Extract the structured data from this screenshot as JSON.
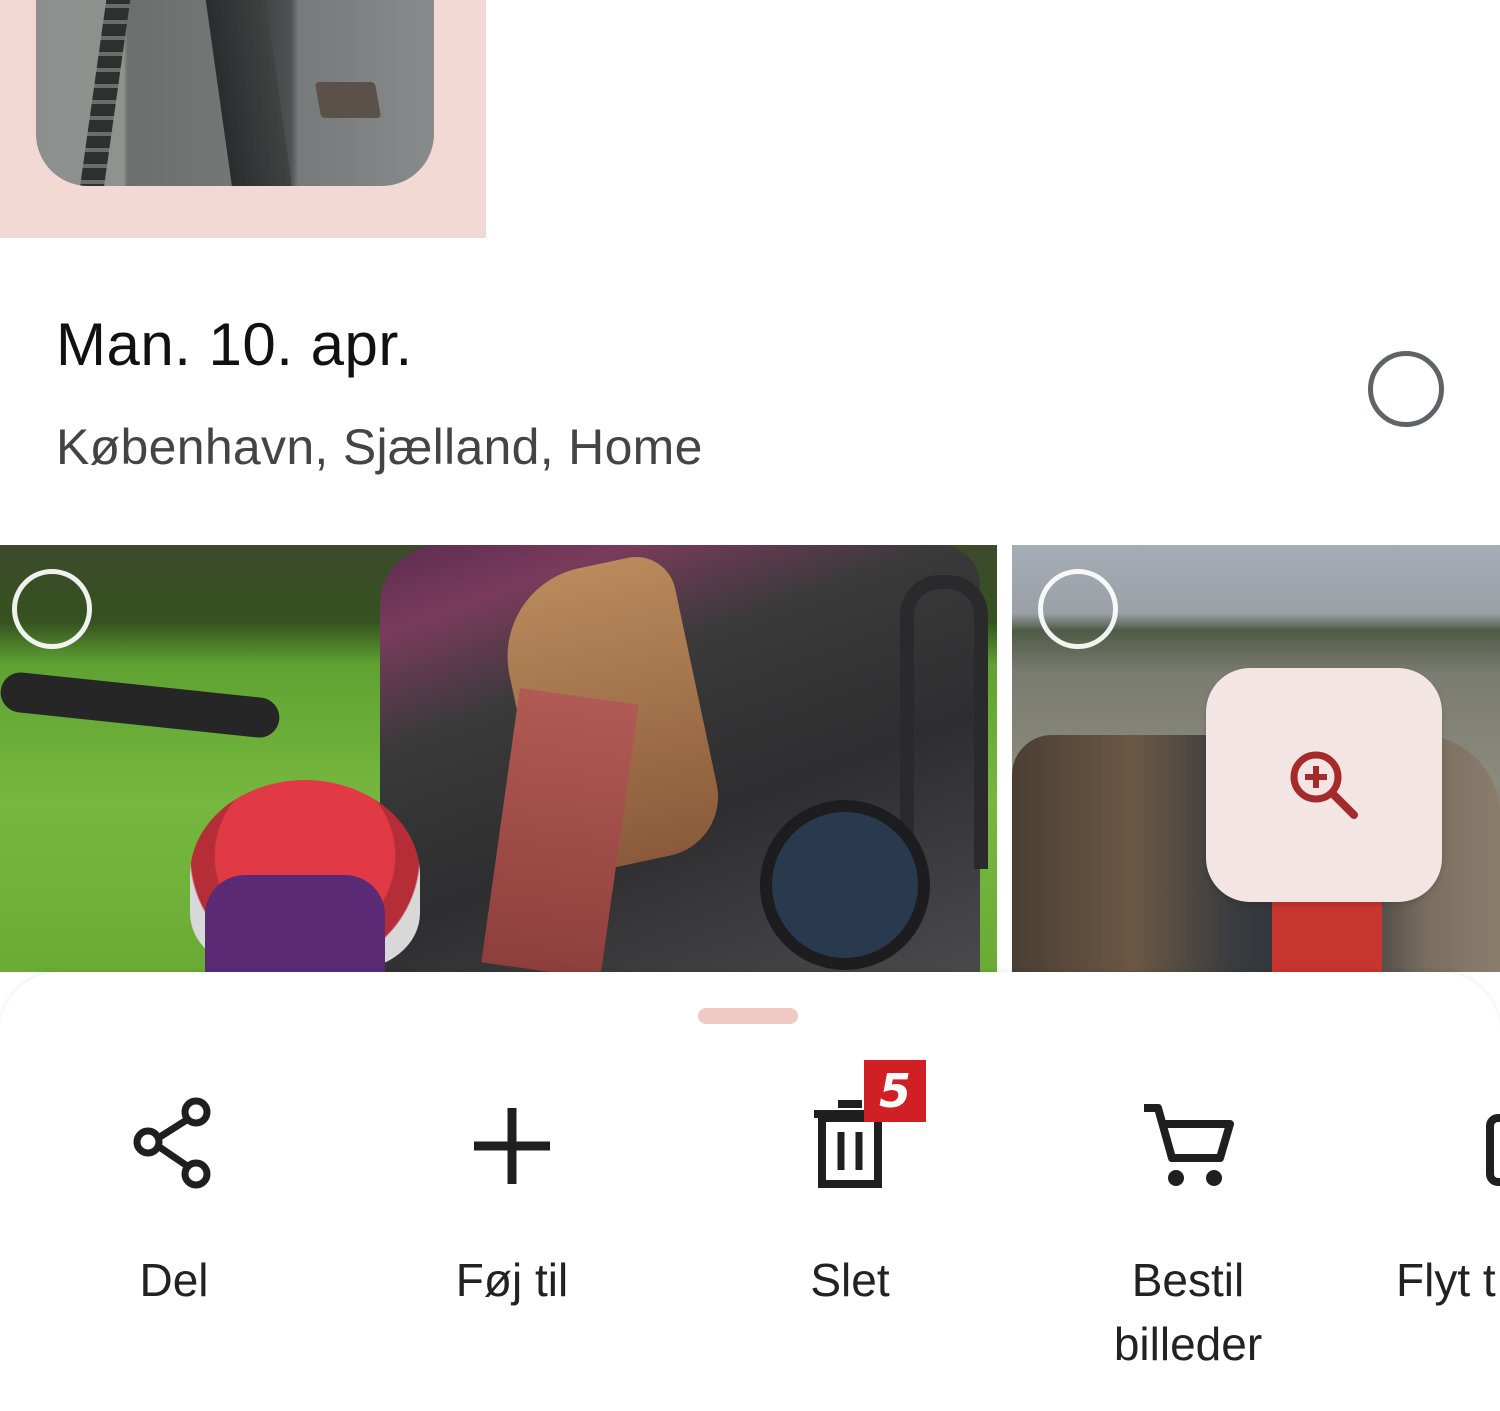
{
  "date_header": {
    "title": "Man. 10. apr.",
    "location": "København, Sjælland, Home",
    "select_all": "unselected"
  },
  "photos": [
    {
      "name": "photo-family-bike",
      "selected": false
    },
    {
      "name": "photo-field-crowd",
      "selected": false
    }
  ],
  "zoom": {
    "icon": "zoom-in-icon"
  },
  "sheet": {
    "actions": [
      {
        "label": "Del",
        "icon": "share-icon"
      },
      {
        "label": "Føj til",
        "icon": "plus-icon"
      },
      {
        "label": "Slet",
        "icon": "trash-icon"
      },
      {
        "label": "Bestil billeder",
        "icon": "cart-icon"
      },
      {
        "label": "Flyt t",
        "icon": "folder-icon"
      }
    ],
    "badge": "5"
  },
  "colors": {
    "selected_bg": "#f3d9d4",
    "accent": "#a52a2a",
    "badge": "#d11f26",
    "handle": "#f0c9c4"
  }
}
